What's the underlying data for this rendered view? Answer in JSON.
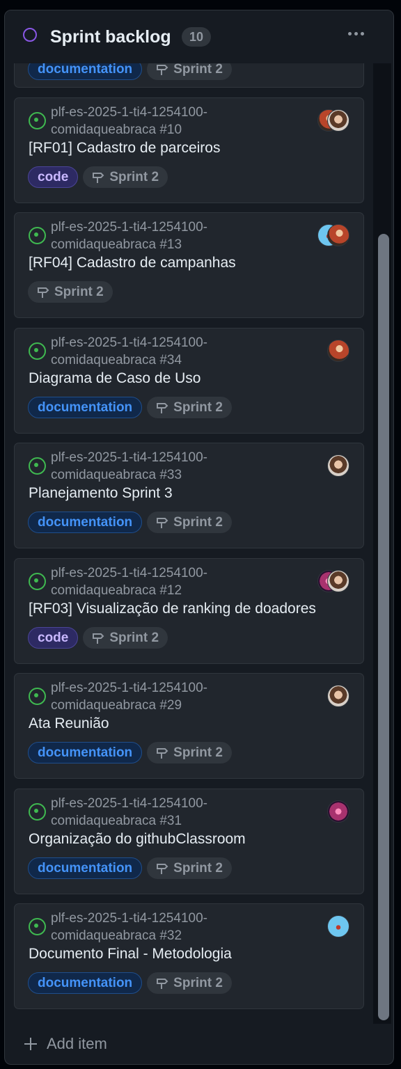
{
  "column": {
    "title": "Sprint backlog",
    "count": "10",
    "status_color": "#8957e5",
    "add_item_label": "Add item"
  },
  "partial_card": {
    "labels": [
      "documentation"
    ],
    "milestone": "Sprint 2"
  },
  "cards": [
    {
      "repo": "plf-es-2025-1-ti4-1254100-comidaqueabraca #10",
      "title": "[RF01] Cadastro de parceiros",
      "labels": [
        "code"
      ],
      "milestone": "Sprint 2",
      "assignees": [
        "avatar-red",
        "avatar-woman"
      ]
    },
    {
      "repo": "plf-es-2025-1-ti4-1254100-comidaqueabraca #13",
      "title": "[RF04] Cadastro de campanhas",
      "labels": [],
      "milestone": "Sprint 2",
      "assignees": [
        "avatar-blue",
        "avatar-red"
      ]
    },
    {
      "repo": "plf-es-2025-1-ti4-1254100-comidaqueabraca #34",
      "title": "Diagrama de Caso de Uso",
      "labels": [
        "documentation"
      ],
      "milestone": "Sprint 2",
      "assignees": [
        "avatar-red"
      ]
    },
    {
      "repo": "plf-es-2025-1-ti4-1254100-comidaqueabraca #33",
      "title": "Planejamento Sprint 3",
      "labels": [
        "documentation"
      ],
      "milestone": "Sprint 2",
      "assignees": [
        "avatar-woman"
      ]
    },
    {
      "repo": "plf-es-2025-1-ti4-1254100-comidaqueabraca #12",
      "title": "[RF03] Visualização de ranking de doadores",
      "labels": [
        "code"
      ],
      "milestone": "Sprint 2",
      "assignees": [
        "avatar-pink",
        "avatar-woman"
      ]
    },
    {
      "repo": "plf-es-2025-1-ti4-1254100-comidaqueabraca #29",
      "title": "Ata Reunião",
      "labels": [
        "documentation"
      ],
      "milestone": "Sprint 2",
      "assignees": [
        "avatar-woman"
      ]
    },
    {
      "repo": "plf-es-2025-1-ti4-1254100-comidaqueabraca #31",
      "title": "Organização do githubClassroom",
      "labels": [
        "documentation"
      ],
      "milestone": "Sprint 2",
      "assignees": [
        "avatar-pink"
      ]
    },
    {
      "repo": "plf-es-2025-1-ti4-1254100-comidaqueabraca #32",
      "title": "Documento Final - Metodologia",
      "labels": [
        "documentation"
      ],
      "milestone": "Sprint 2",
      "assignees": [
        "avatar-blue"
      ]
    }
  ],
  "colors": {
    "documentation_label": "#4493f8",
    "code_label": "#c9b8ff",
    "open_issue": "#3fb950"
  }
}
